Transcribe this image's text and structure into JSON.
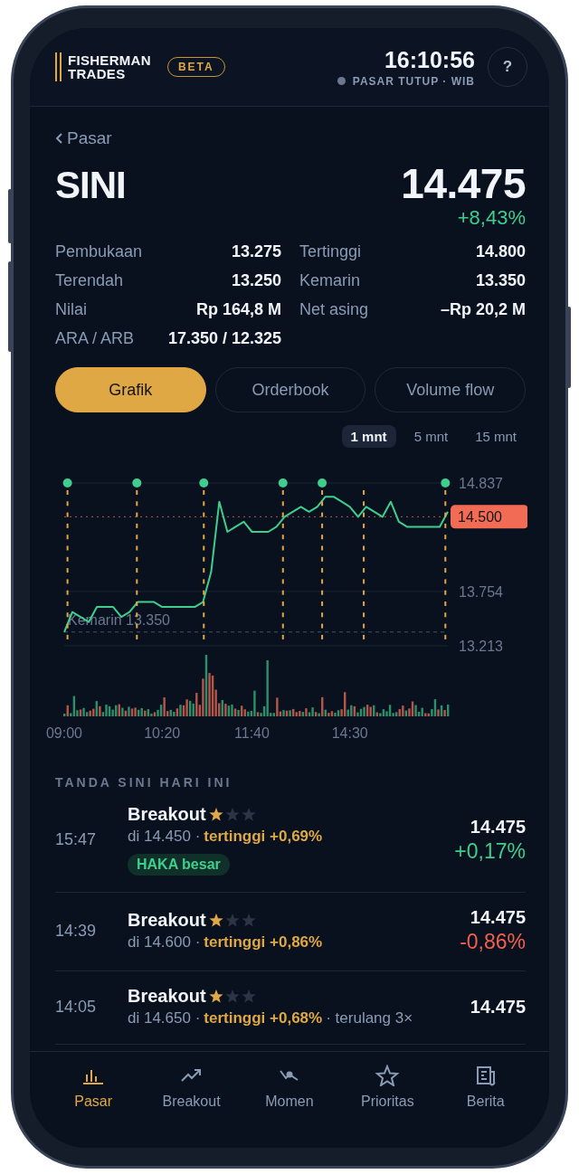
{
  "header": {
    "logo_lines": [
      "FISHERMAN",
      "TRADES"
    ],
    "badge": "BETA",
    "clock": "16:10:56",
    "market_status": "PASAR TUTUP · WIB",
    "help": "?"
  },
  "back": {
    "label": "Pasar"
  },
  "quote": {
    "symbol": "SINI",
    "price": "14.475",
    "change": "+8,43%",
    "color": "#3ecf8e"
  },
  "stats": [
    {
      "label": "Pembukaan",
      "value": "13.275"
    },
    {
      "label": "Tertinggi",
      "value": "14.800"
    },
    {
      "label": "Terendah",
      "value": "13.250"
    },
    {
      "label": "Kemarin",
      "value": "13.350"
    },
    {
      "label": "Nilai",
      "value": "Rp 164,8 M"
    },
    {
      "label": "Net asing",
      "value": "–Rp 20,2 M"
    },
    {
      "label": "ARA / ARB",
      "value": "17.350 / 12.325"
    }
  ],
  "tabs": [
    {
      "label": "Grafik",
      "selected": true
    },
    {
      "label": "Orderbook",
      "selected": false
    },
    {
      "label": "Volume flow",
      "selected": false
    }
  ],
  "intervals": [
    {
      "label": "1 mnt",
      "selected": true
    },
    {
      "label": "5 mnt",
      "selected": false
    },
    {
      "label": "15 mnt",
      "selected": false
    }
  ],
  "chart": {
    "chart_data": {
      "type": "line",
      "categories": [
        "09:00",
        null,
        null,
        null,
        null,
        null,
        null,
        null,
        null,
        null,
        null,
        null,
        "10:20",
        null,
        null,
        null,
        null,
        null,
        null,
        null,
        null,
        null,
        null,
        "11:40",
        null,
        null,
        null,
        null,
        null,
        null,
        null,
        null,
        null,
        null,
        null,
        "14:30",
        null,
        null,
        null,
        null,
        null,
        null,
        null,
        null,
        null,
        null,
        null,
        null
      ],
      "series": [
        {
          "color": "#3ecf8e",
          "values": [
            13.35,
            13.55,
            13.5,
            13.45,
            13.6,
            13.6,
            13.6,
            13.5,
            13.55,
            13.65,
            13.65,
            13.65,
            13.6,
            13.6,
            13.6,
            13.6,
            13.6,
            13.65,
            13.95,
            14.65,
            14.35,
            14.4,
            14.45,
            14.35,
            14.35,
            14.35,
            14.4,
            14.5,
            14.55,
            14.6,
            14.55,
            14.6,
            14.7,
            14.7,
            14.65,
            14.6,
            14.5,
            14.6,
            14.55,
            14.5,
            14.65,
            14.45,
            14.4,
            14.4,
            14.4,
            14.4,
            14.4,
            14.55
          ]
        }
      ],
      "ylim": [
        13.213,
        14.837
      ],
      "yticks": [
        14.837,
        13.754,
        13.213
      ],
      "grid": true,
      "ref_lines": [
        {
          "axis": "y",
          "value": 14.5,
          "label": "14.500"
        },
        {
          "axis": "y",
          "value": 13.35,
          "label": "Kemarin 13.350"
        }
      ]
    }
  },
  "signals_title": "TANDA SINI HARI INI",
  "signals": [
    {
      "time": "15:47",
      "title": "Breakout",
      "stars": 1,
      "detail": "di 14.450 ·",
      "peak": "tertinggi +0,69%",
      "tag": "HAKA besar",
      "price": "14.475",
      "change": "+0,17%",
      "color": "#3ecf8e"
    },
    {
      "time": "14:39",
      "title": "Breakout",
      "stars": 1,
      "detail": "di 14.600 ·",
      "peak": "tertinggi +0,86%",
      "price": "14.475",
      "change": "-0,86%",
      "color": "#f0604d"
    },
    {
      "time": "14:05",
      "title": "Breakout",
      "stars": 1,
      "detail": "di 14.650 ·",
      "peak": "tertinggi +0,68%",
      "note": "· terulang 3×",
      "price": "14.475"
    }
  ],
  "nav": [
    {
      "label": "Pasar",
      "selected": true
    },
    {
      "label": "Breakout",
      "selected": false
    },
    {
      "label": "Momen",
      "selected": false
    },
    {
      "label": "Prioritas",
      "selected": false
    },
    {
      "label": "Berita",
      "selected": false
    }
  ]
}
